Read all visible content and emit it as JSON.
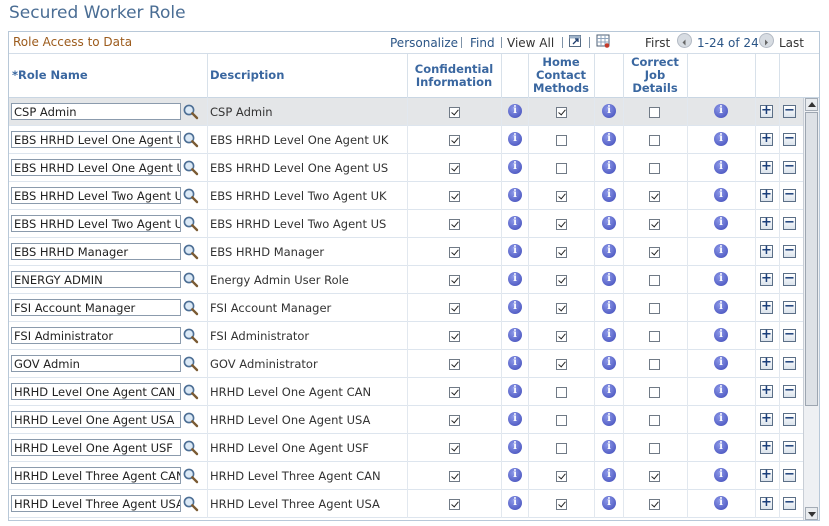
{
  "page": {
    "title": "Secured Worker Role"
  },
  "grid": {
    "title": "Role Access to Data",
    "nav": {
      "personalize": "Personalize",
      "find": "Find",
      "view_all": "View All",
      "first": "First",
      "range": "1-24 of 24",
      "last": "Last",
      "zoom_icon": "zoom-icon",
      "download_icon": "download-spreadsheet-icon"
    },
    "columns": {
      "role_name": "*Role Name",
      "description": "Description",
      "confidential": [
        "Confidential",
        "Information"
      ],
      "home_contact": [
        "Home",
        "Contact",
        "Methods"
      ],
      "correct_job": [
        "Correct",
        "Job",
        "Details"
      ]
    },
    "rows": [
      {
        "role": "CSP Admin",
        "description": "CSP Admin",
        "confidential": true,
        "home_contact": true,
        "correct_job": false
      },
      {
        "role": "EBS HRHD Level One Agent UK",
        "description": "EBS HRHD Level One Agent UK",
        "confidential": true,
        "home_contact": false,
        "correct_job": false
      },
      {
        "role": "EBS HRHD Level One Agent US",
        "description": "EBS HRHD Level One Agent US",
        "confidential": true,
        "home_contact": false,
        "correct_job": false
      },
      {
        "role": "EBS HRHD Level Two Agent UK",
        "description": "EBS HRHD Level Two Agent UK",
        "confidential": true,
        "home_contact": true,
        "correct_job": true
      },
      {
        "role": "EBS HRHD Level Two Agent US",
        "description": "EBS HRHD Level Two Agent US",
        "confidential": true,
        "home_contact": true,
        "correct_job": true
      },
      {
        "role": "EBS HRHD Manager",
        "description": "EBS HRHD Manager",
        "confidential": true,
        "home_contact": true,
        "correct_job": true
      },
      {
        "role": "ENERGY ADMIN",
        "description": "Energy Admin User Role",
        "confidential": true,
        "home_contact": true,
        "correct_job": false
      },
      {
        "role": "FSI Account Manager",
        "description": "FSI Account Manager",
        "confidential": true,
        "home_contact": true,
        "correct_job": false
      },
      {
        "role": "FSI Administrator",
        "description": "FSI Administrator",
        "confidential": true,
        "home_contact": true,
        "correct_job": false
      },
      {
        "role": "GOV Admin",
        "description": "GOV Administrator",
        "confidential": true,
        "home_contact": true,
        "correct_job": false
      },
      {
        "role": "HRHD Level One Agent CAN",
        "description": "HRHD Level One Agent CAN",
        "confidential": true,
        "home_contact": false,
        "correct_job": false
      },
      {
        "role": "HRHD Level One Agent USA",
        "description": "HRHD Level One Agent USA",
        "confidential": true,
        "home_contact": false,
        "correct_job": false
      },
      {
        "role": "HRHD Level One Agent USF",
        "description": "HRHD Level One Agent USF",
        "confidential": true,
        "home_contact": false,
        "correct_job": false
      },
      {
        "role": "HRHD Level Three Agent CAN",
        "description": "HRHD Level Three Agent CAN",
        "confidential": true,
        "home_contact": true,
        "correct_job": true
      },
      {
        "role": "HRHD Level Three Agent USA",
        "description": "HRHD Level Three Agent USA",
        "confidential": true,
        "home_contact": true,
        "correct_job": true
      }
    ],
    "row_icons": {
      "lookup": "lookup-magnifier-icon",
      "info": "info-icon",
      "add": "+",
      "delete": "−"
    },
    "selected_row": 0
  }
}
